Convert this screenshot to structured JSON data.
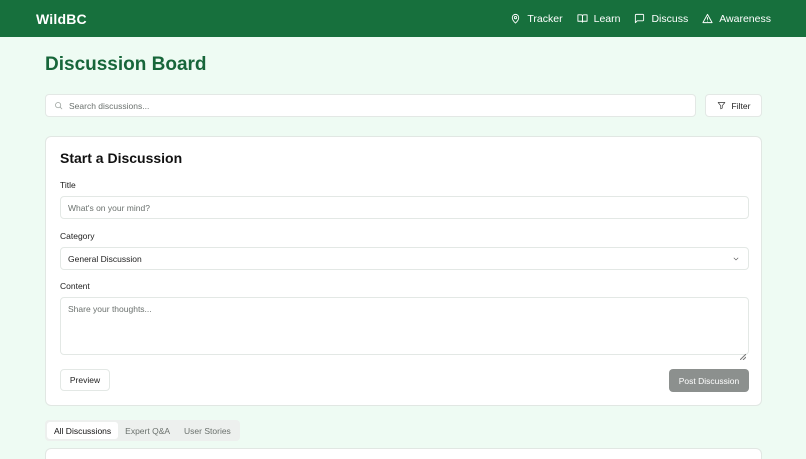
{
  "header": {
    "brand": "WildBC",
    "nav": [
      {
        "label": "Tracker",
        "icon": "map-pin-icon"
      },
      {
        "label": "Learn",
        "icon": "book-icon"
      },
      {
        "label": "Discuss",
        "icon": "message-square-icon"
      },
      {
        "label": "Awareness",
        "icon": "alert-triangle-icon"
      }
    ]
  },
  "page": {
    "title": "Discussion Board"
  },
  "search": {
    "placeholder": "Search discussions..."
  },
  "filter": {
    "label": "Filter"
  },
  "form": {
    "heading": "Start a Discussion",
    "title_label": "Title",
    "title_placeholder": "What's on your mind?",
    "category_label": "Category",
    "category_value": "General Discussion",
    "content_label": "Content",
    "content_placeholder": "Share your thoughts...",
    "preview_label": "Preview",
    "post_label": "Post Discussion"
  },
  "tabs": [
    {
      "label": "All Discussions",
      "active": true
    },
    {
      "label": "Expert Q&A",
      "active": false
    },
    {
      "label": "User Stories",
      "active": false
    }
  ],
  "colors": {
    "brand_green": "#17703d",
    "title_green": "#17663a",
    "background": "#eefbf3",
    "disabled_button": "#8c908e"
  }
}
